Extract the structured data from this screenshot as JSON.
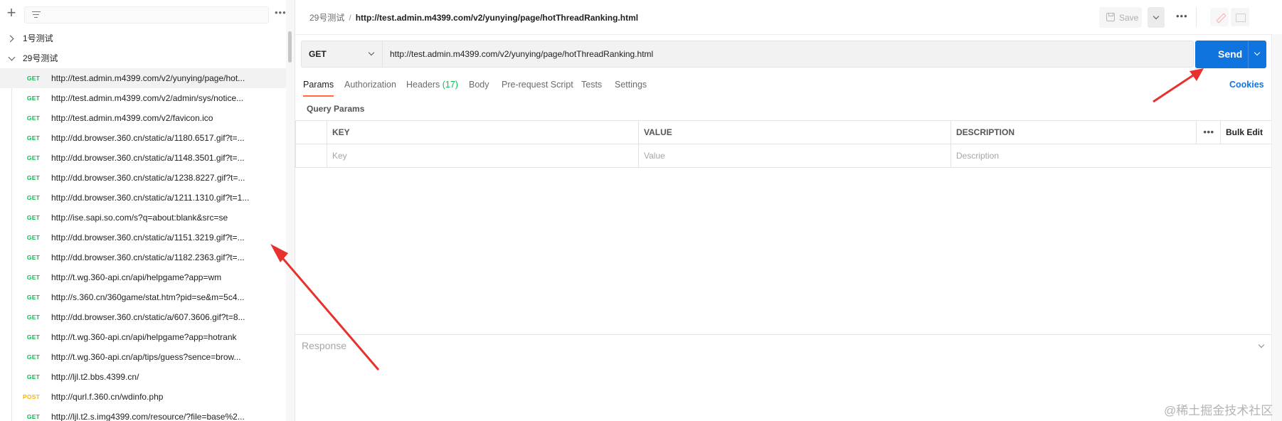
{
  "sidebar": {
    "add_icon": "plus-icon",
    "filter_icon": "filter-icon",
    "more_label": "•••",
    "folders": [
      {
        "name": "1号测试",
        "state": "collapsed"
      },
      {
        "name": "29号测试",
        "state": "expanded"
      }
    ],
    "requests": [
      {
        "method": "GET",
        "url": "http://test.admin.m4399.com/v2/yunying/page/hot..."
      },
      {
        "method": "GET",
        "url": "http://test.admin.m4399.com/v2/admin/sys/notice..."
      },
      {
        "method": "GET",
        "url": "http://test.admin.m4399.com/v2/favicon.ico"
      },
      {
        "method": "GET",
        "url": "http://dd.browser.360.cn/static/a/1180.6517.gif?t=..."
      },
      {
        "method": "GET",
        "url": "http://dd.browser.360.cn/static/a/1148.3501.gif?t=..."
      },
      {
        "method": "GET",
        "url": "http://dd.browser.360.cn/static/a/1238.8227.gif?t=..."
      },
      {
        "method": "GET",
        "url": "http://dd.browser.360.cn/static/a/1211.1310.gif?t=1..."
      },
      {
        "method": "GET",
        "url": "http://ise.sapi.so.com/s?q=about:blank&src=se"
      },
      {
        "method": "GET",
        "url": "http://dd.browser.360.cn/static/a/1151.3219.gif?t=..."
      },
      {
        "method": "GET",
        "url": "http://dd.browser.360.cn/static/a/1182.2363.gif?t=..."
      },
      {
        "method": "GET",
        "url": "http://t.wg.360-api.cn/api/helpgame?app=wm"
      },
      {
        "method": "GET",
        "url": "http://s.360.cn/360game/stat.htm?pid=se&m=5c4..."
      },
      {
        "method": "GET",
        "url": "http://dd.browser.360.cn/static/a/607.3606.gif?t=8..."
      },
      {
        "method": "GET",
        "url": "http://t.wg.360-api.cn/api/helpgame?app=hotrank"
      },
      {
        "method": "GET",
        "url": "http://t.wg.360-api.cn/ap/tips/guess?sence=brow..."
      },
      {
        "method": "GET",
        "url": "http://ljl.t2.bbs.4399.cn/"
      },
      {
        "method": "POST",
        "url": "http://qurl.f.360.cn/wdinfo.php"
      },
      {
        "method": "GET",
        "url": "http://ljl.t2.s.img4399.com/resource/?file=base%2..."
      }
    ]
  },
  "header": {
    "collection": "29号测试",
    "separator": "/",
    "request_name": "http://test.admin.m4399.com/v2/yunying/page/hotThreadRanking.html",
    "save_label": "Save",
    "more_label": "•••"
  },
  "request": {
    "method": "GET",
    "url": "http://test.admin.m4399.com/v2/yunying/page/hotThreadRanking.html",
    "send_label": "Send"
  },
  "tabs": [
    {
      "label": "Params",
      "active": true
    },
    {
      "label": "Authorization"
    },
    {
      "label": "Headers",
      "count": "(17)"
    },
    {
      "label": "Body"
    },
    {
      "label": "Pre-request Script"
    },
    {
      "label": "Tests"
    },
    {
      "label": "Settings"
    }
  ],
  "cookies_label": "Cookies",
  "params": {
    "section_title": "Query Params",
    "columns": [
      "KEY",
      "VALUE",
      "DESCRIPTION"
    ],
    "more_label": "•••",
    "bulk_edit_label": "Bulk Edit",
    "placeholders": {
      "key": "Key",
      "value": "Value",
      "description": "Description"
    }
  },
  "response": {
    "title": "Response"
  },
  "watermark": "@稀土掘金技术社区",
  "colors": {
    "accent": "#0f74de",
    "active_tab": "#ff6c37",
    "get": "#0cbb52",
    "post": "#ffb400",
    "arrow": "#e8312d"
  }
}
